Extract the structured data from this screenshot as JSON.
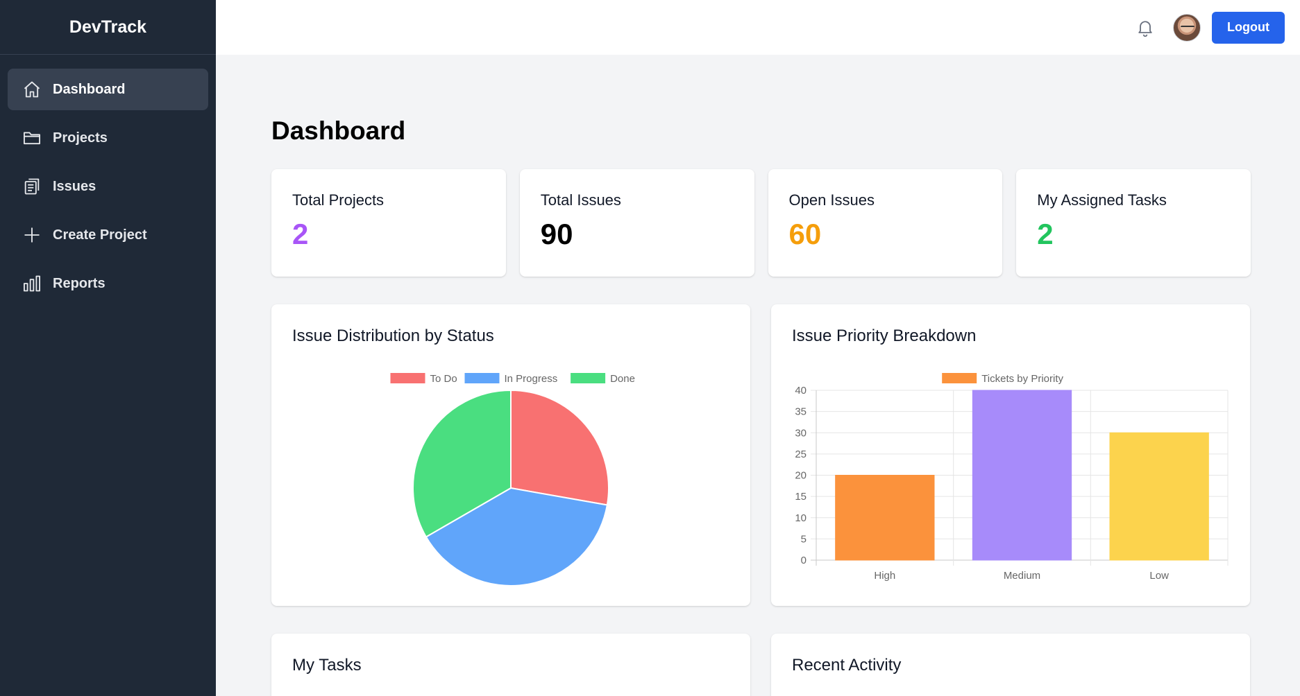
{
  "app": {
    "brand": "DevTrack"
  },
  "sidebar": {
    "items": [
      {
        "label": "Dashboard",
        "icon": "home-icon",
        "active": true
      },
      {
        "label": "Projects",
        "icon": "folder-icon",
        "active": false
      },
      {
        "label": "Issues",
        "icon": "clipboard-icon",
        "active": false
      },
      {
        "label": "Create Project",
        "icon": "plus-icon",
        "active": false
      },
      {
        "label": "Reports",
        "icon": "bar-chart-icon",
        "active": false
      }
    ]
  },
  "topbar": {
    "logout_label": "Logout"
  },
  "page": {
    "title": "Dashboard"
  },
  "stats": [
    {
      "label": "Total Projects",
      "value": "2",
      "color": "#a855f7"
    },
    {
      "label": "Total Issues",
      "value": "90",
      "color": "#000000"
    },
    {
      "label": "Open Issues",
      "value": "60",
      "color": "#f59e0b"
    },
    {
      "label": "My Assigned Tasks",
      "value": "2",
      "color": "#22c55e"
    }
  ],
  "charts": {
    "status_title": "Issue Distribution by Status",
    "priority_title": "Issue Priority Breakdown"
  },
  "chart_data": [
    {
      "type": "pie",
      "title": "Issue Distribution by Status",
      "categories": [
        "To Do",
        "In Progress",
        "Done"
      ],
      "values": [
        25,
        35,
        30
      ],
      "colors": [
        "#f87171",
        "#60a5fa",
        "#4ade80"
      ],
      "legend": "top"
    },
    {
      "type": "bar",
      "title": "Issue Priority Breakdown",
      "categories": [
        "High",
        "Medium",
        "Low"
      ],
      "series": [
        {
          "name": "Tickets by Priority",
          "values": [
            20,
            40,
            30
          ]
        }
      ],
      "colors": [
        "#fb923c",
        "#a78bfa",
        "#fcd34d"
      ],
      "ylim": [
        0,
        40
      ],
      "yticks": [
        0,
        5,
        10,
        15,
        20,
        25,
        30,
        35,
        40
      ],
      "grid": true,
      "legend": "top"
    }
  ],
  "bottom": {
    "tasks_title": "My Tasks",
    "activity_title": "Recent Activity"
  }
}
